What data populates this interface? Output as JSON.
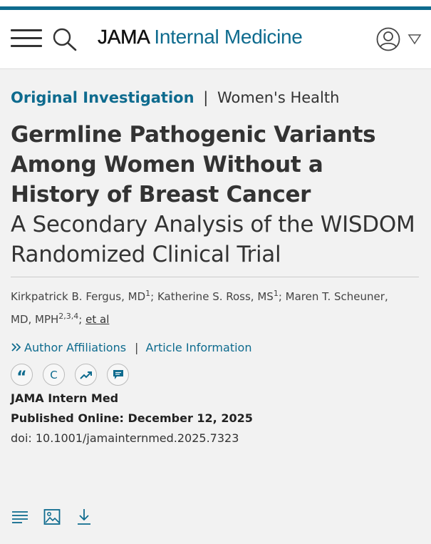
{
  "header": {
    "brand_prefix": "JAMA",
    "brand_suffix": "Internal Medicine",
    "accent_color": "#0e6b8e",
    "icons": [
      "menu-icon",
      "search-icon",
      "user-icon",
      "caret-down-icon"
    ]
  },
  "article": {
    "type": "Original Investigation",
    "separator": "|",
    "topic": "Women's Health",
    "title": "Germline Pathogenic Variants Among Women Without a History of Breast Cancer",
    "subtitle": "A Secondary Analysis of the WISDOM Randomized Clinical Trial"
  },
  "authors": {
    "a1_name": "Kirkpatrick B. Fergus, MD",
    "a1_sup": "1",
    "a2_name": "Katherine S. Ross, MS",
    "a2_sup": "1",
    "a3_name": "Maren T. Scheuner, MD, MPH",
    "a3_sup": "2,3,4",
    "sep": "; ",
    "et_al": "et al"
  },
  "links": {
    "affiliations": "Author Affiliations",
    "pipe": "|",
    "article_info": "Article Information"
  },
  "actions": {
    "cite_glyph": "“",
    "copyright_glyph": "C",
    "icons": [
      "quote-icon",
      "copyright-icon",
      "metrics-icon",
      "comment-icon"
    ]
  },
  "meta": {
    "journal": "JAMA Intern Med",
    "published": "Published Online: December 12, 2025",
    "doi": "doi: 10.1001/jamainternmed.2025.7323"
  },
  "bottom_toolbar": {
    "icons": [
      "outline-icon",
      "figures-icon",
      "download-icon"
    ]
  }
}
